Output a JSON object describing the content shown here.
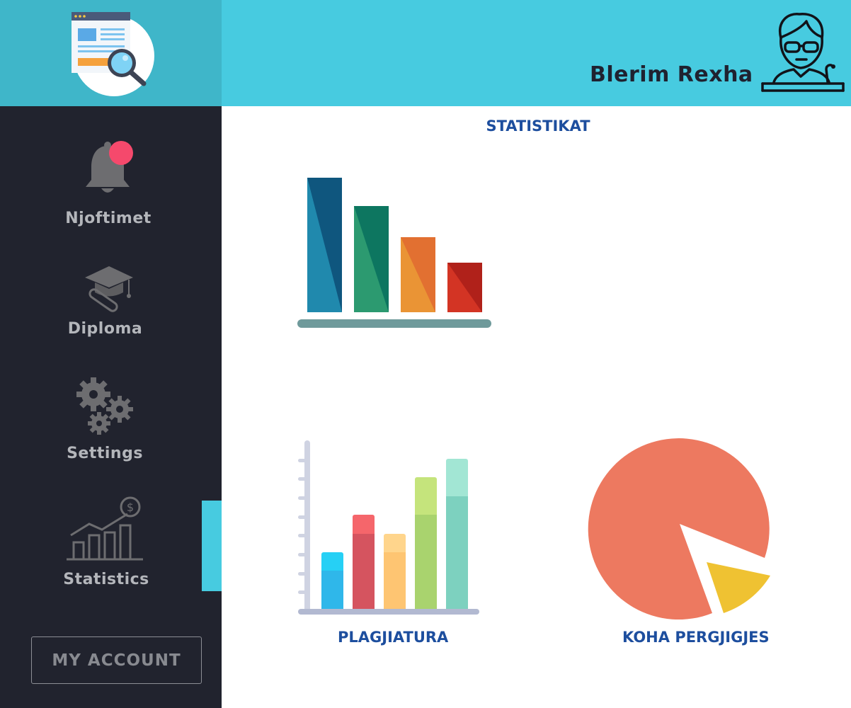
{
  "header": {
    "user_name": "Blerim Rexha",
    "avatar_icon": "teacher-avatar-icon",
    "logo_icon": "document-search-logo-icon"
  },
  "sidebar": {
    "items": [
      {
        "label": "Njoftimet",
        "icon": "bell-icon",
        "badge_color": "#f5496c"
      },
      {
        "label": "Diploma",
        "icon": "graduation-cap-diploma-icon"
      },
      {
        "label": "Settings",
        "icon": "gears-icon"
      },
      {
        "label": "Statistics",
        "icon": "bar-growth-dollar-icon",
        "active": true
      }
    ],
    "account_button": "MY ACCOUNT"
  },
  "main": {
    "title": "STATISTIKAT",
    "charts": [
      {
        "label": "PLAGJIATURA",
        "icon": "stacked-bar-chart-icon"
      },
      {
        "label": "KOHA PERGJIGJES",
        "icon": "pie-chart-icon"
      }
    ]
  },
  "colors": {
    "sidebar_bg": "#21232e",
    "topbar_bg": "#47cbe0",
    "logo_bg": "#3fb6c9",
    "accent": "#47cbe0",
    "title_text": "#1d4e9e"
  }
}
